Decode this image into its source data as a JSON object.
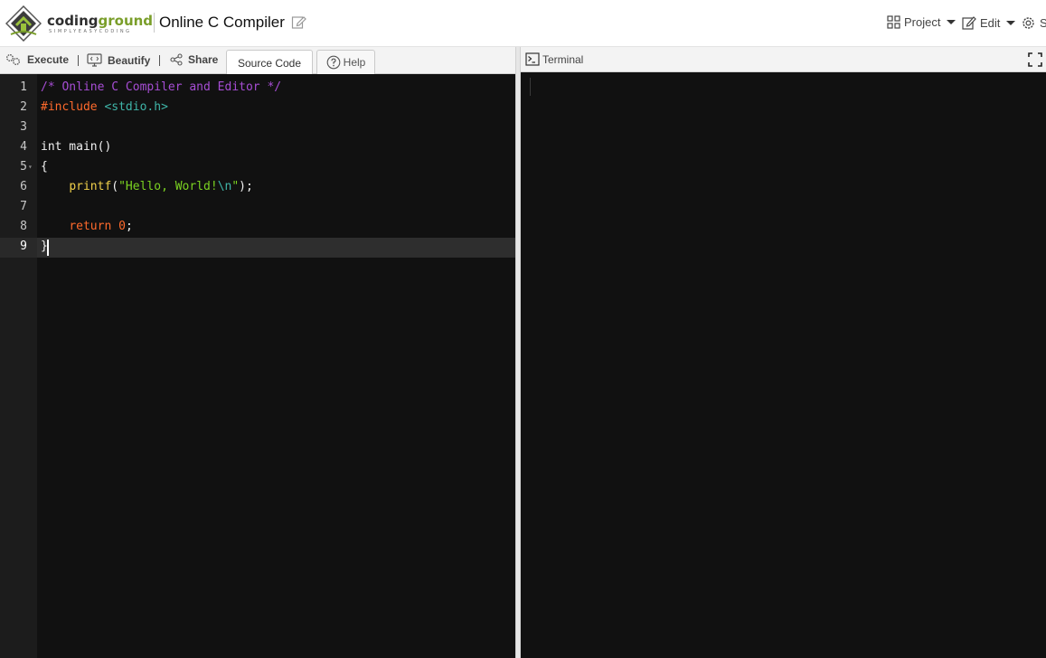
{
  "app": {
    "brand": "codingground",
    "brand_tagline": "SIMPLYEASYCODING",
    "title": "Online C Compiler"
  },
  "menu": {
    "project_label": "Project",
    "edit_label": "Edit",
    "settings_label": "S"
  },
  "toolbar": {
    "execute_label": "Execute",
    "beautify_label": "Beautify",
    "share_label": "Share",
    "source_code_tab": "Source Code",
    "help_tab": "Help"
  },
  "editor": {
    "active_line": 9,
    "lines": [
      {
        "number": "1",
        "tokens": [
          {
            "t": "comment",
            "v": "/* Online C Compiler and Editor */"
          }
        ]
      },
      {
        "number": "2",
        "tokens": [
          {
            "t": "pre",
            "v": "#include "
          },
          {
            "t": "inc",
            "v": "<stdio.h>"
          }
        ]
      },
      {
        "number": "3",
        "tokens": []
      },
      {
        "number": "4",
        "tokens": [
          {
            "t": "plain",
            "v": "int main()"
          }
        ]
      },
      {
        "number": "5",
        "tokens": [
          {
            "t": "plain",
            "v": "{"
          }
        ],
        "fold": true
      },
      {
        "number": "6",
        "tokens": [
          {
            "t": "plain",
            "v": "    "
          },
          {
            "t": "func",
            "v": "printf"
          },
          {
            "t": "plain",
            "v": "("
          },
          {
            "t": "str",
            "v": "\"Hello, World!"
          },
          {
            "t": "esc",
            "v": "\\n"
          },
          {
            "t": "str",
            "v": "\""
          },
          {
            "t": "plain",
            "v": ");"
          }
        ]
      },
      {
        "number": "7",
        "tokens": []
      },
      {
        "number": "8",
        "tokens": [
          {
            "t": "plain",
            "v": "    "
          },
          {
            "t": "kw",
            "v": "return"
          },
          {
            "t": "plain",
            "v": " "
          },
          {
            "t": "num",
            "v": "0"
          },
          {
            "t": "plain",
            "v": ";"
          }
        ]
      },
      {
        "number": "9",
        "tokens": [
          {
            "t": "plain",
            "v": "}"
          }
        ]
      }
    ]
  },
  "terminal": {
    "title": "Terminal",
    "output": ""
  },
  "colors": {
    "editor_bg": "#111111",
    "gutter_bg": "#1c1c1c",
    "comment": "#a64dd4",
    "preprocessor": "#ff6a2c",
    "include": "#3fb5a8",
    "function": "#f0d04a",
    "string": "#7bd321",
    "brand_green": "#7a9e2a"
  },
  "icons": {
    "logo": "codingground-logo-icon",
    "title_edit": "pencil-icon",
    "project": "grid-icon",
    "edit": "edit-icon",
    "settings": "gear-icon",
    "execute": "gears-icon",
    "beautify": "monitor-icon",
    "share": "share-icon",
    "help": "question-circle-icon",
    "terminal": "terminal-icon",
    "fullscreen": "fullscreen-icon",
    "fold": "fold-arrow-icon"
  }
}
